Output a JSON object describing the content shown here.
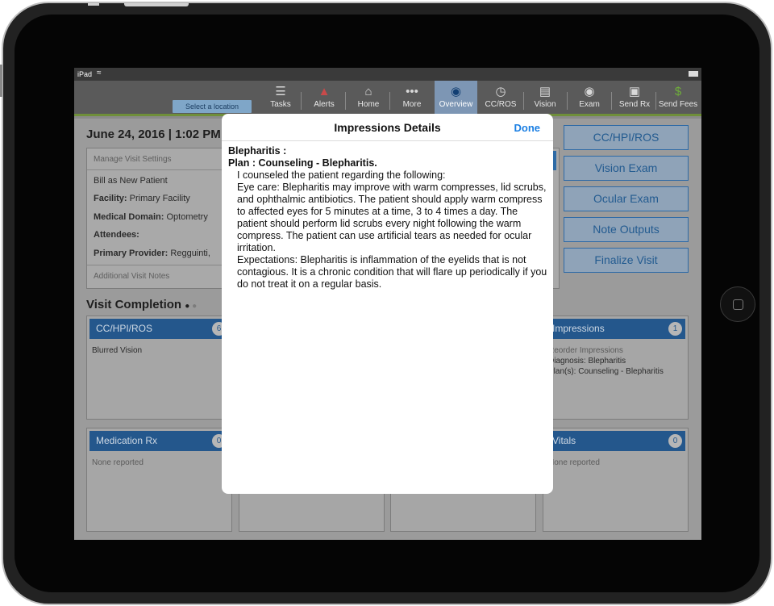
{
  "status": {
    "carrier": "iPad"
  },
  "nav": {
    "location_button": "Select a location",
    "items": [
      {
        "label": "Tasks",
        "icon": "tasks-icon"
      },
      {
        "label": "Alerts",
        "icon": "megaphone-icon"
      },
      {
        "label": "Home",
        "icon": "home-icon"
      },
      {
        "label": "More",
        "icon": "more-icon"
      },
      {
        "label": "Overview",
        "icon": "person-icon",
        "active": true
      },
      {
        "label": "CC/ROS",
        "icon": "clock-icon"
      },
      {
        "label": "Vision",
        "icon": "document-icon"
      },
      {
        "label": "Exam",
        "icon": "eye-icon"
      },
      {
        "label": "Send Rx",
        "icon": "send-rx-icon"
      },
      {
        "label": "Send Fees",
        "icon": "dollar-doc-icon"
      }
    ],
    "active_color": "#7d96b4",
    "accent_color": "#6f8f3a"
  },
  "visit": {
    "date": "June 24, 2016 | 1:02 PM",
    "settings": {
      "header": "Manage Visit Settings",
      "bill": "Bill as New Patient",
      "facility_label": "Facility:",
      "facility_value": "Primary Facility",
      "domain_label": "Medical Domain:",
      "domain_value": "Optometry",
      "attendees_label": "Attendees:",
      "provider_label": "Primary Provider:",
      "provider_value": "Regguinti,",
      "notes": "Additional Visit Notes"
    },
    "completion_title": "Visit Completion",
    "buttons": [
      "CC/HPI/ROS",
      "Vision Exam",
      "Ocular Exam",
      "Note Outputs",
      "Finalize Visit"
    ]
  },
  "cards": {
    "cc": {
      "title": "CC/HPI/ROS",
      "badge": "6",
      "body": "Blurred Vision"
    },
    "impressions": {
      "title": "Impressions",
      "badge": "1",
      "lines": [
        "Reorder Impressions",
        "Diagnosis: Blepharitis",
        "Plan(s): Counseling - Blepharitis"
      ]
    },
    "medication": {
      "title": "Medication Rx",
      "badge": "0",
      "body": "None reported"
    },
    "vitals": {
      "title": "Vitals",
      "badge": "0",
      "body": "None reported"
    }
  },
  "modal": {
    "title": "Impressions Details",
    "done": "Done",
    "diagnosis": "Blepharitis :",
    "plan": "Plan : Counseling - Blepharitis.",
    "lines": [
      "I counseled the patient regarding the following:",
      "Eye care: Blepharitis may improve with warm compresses, lid scrubs, and ophthalmic antibiotics. The patient should apply warm compress to affected eyes for 5 minutes at a time, 3 to 4 times a day.  The patient should perform lid scrubs every night following the warm compress. The patient can use artificial tears as needed for ocular irritation.",
      "Expectations: Blepharitis is inflammation of the eyelids that is not contagious.  It is a chronic condition that will flare up periodically if you do not treat it on a regular basis."
    ],
    "done_color": "#1b7fe3"
  }
}
